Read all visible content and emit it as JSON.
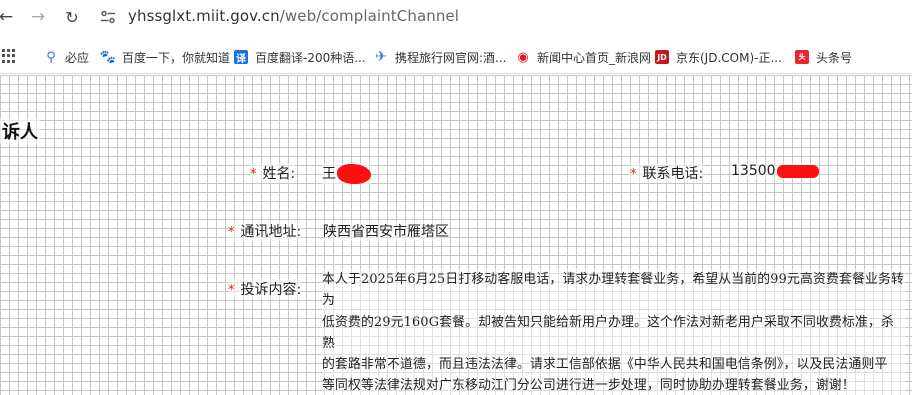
{
  "browser": {
    "url_host": "yhssglxt.miit.gov.cn",
    "url_path": "/web/complaintChannel",
    "bookmarks": [
      {
        "label": "必应",
        "icon": "search-icon",
        "color": "#3a6fd8"
      },
      {
        "label": "百度一下，你就知道",
        "icon": "baidu-paw-icon",
        "color": "#2f5bd3"
      },
      {
        "label": "百度翻译-200种语...",
        "icon": "translate-icon",
        "color": "#1e6ee8"
      },
      {
        "label": "携程旅行网官网:酒...",
        "icon": "ctrip-icon",
        "color": "#2a7be4"
      },
      {
        "label": "新闻中心首页_新浪网",
        "icon": "weibo-icon",
        "color": "#e6162d"
      },
      {
        "label": "京东(JD.COM)-正...",
        "icon": "jd-icon",
        "color": "#c9151e"
      },
      {
        "label": "头条号",
        "icon": "toutiao-icon",
        "color": "#e8262f"
      }
    ]
  },
  "form": {
    "section_title": "诉人",
    "required_mark": "*",
    "name_label": "姓名:",
    "name_value": "王",
    "phone_label": "联系电话:",
    "phone_value": "13500",
    "address_label": "通讯地址:",
    "address_value": "陕西省西安市雁塔区",
    "content_label": "投诉内容:",
    "content_lines": [
      "本人于2025年6月25日打移动客服电话，请求办理转套餐业务，希望从当前的99元高资费套餐业务转为",
      "低资费的29元160G套餐。却被告知只能给新用户办理。这个作法对新老用户采取不同收费标准，杀熟",
      "的套路非常不道德，而且违法法律。请求工信部依据《中华人民共和国电信条例》，以及民法通则平",
      "等同权等法律法规对广东移动江门分公司进行进一步处理，同时协助办理转套餐业务，谢谢！"
    ]
  }
}
